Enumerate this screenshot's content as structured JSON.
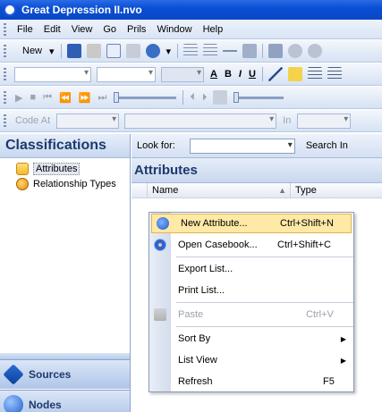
{
  "window": {
    "title": "Great Depression II.nvo"
  },
  "menubar": {
    "items": [
      "File",
      "Edit",
      "View",
      "Go",
      "Prils",
      "Window",
      "Help"
    ]
  },
  "toolbar1": {
    "new_label": "New"
  },
  "toolbar4": {
    "code_at_label": "Code At",
    "in_label": "In"
  },
  "left_panel": {
    "header": "Classifications",
    "tree": [
      {
        "label": "Attributes",
        "icon": "attributes-folder-icon",
        "selected": true
      },
      {
        "label": "Relationship Types",
        "icon": "relationship-types-icon",
        "selected": false
      }
    ],
    "nav": [
      {
        "label": "Sources",
        "icon": "sources-icon"
      },
      {
        "label": "Nodes",
        "icon": "nodes-icon"
      }
    ]
  },
  "find_bar": {
    "look_for_label": "Look for:",
    "search_in_label": "Search In"
  },
  "list": {
    "header": "Attributes",
    "columns": [
      "Name",
      "Type"
    ]
  },
  "context_menu": {
    "items": [
      {
        "label": "New Attribute...",
        "shortcut": "Ctrl+Shift+N",
        "icon": "new-attribute-icon",
        "highlighted": true
      },
      {
        "label": "Open Casebook...",
        "shortcut": "Ctrl+Shift+C",
        "icon": "casebook-icon"
      },
      {
        "label": "Export List...",
        "shortcut": ""
      },
      {
        "label": "Print List...",
        "shortcut": ""
      },
      {
        "label": "Paste",
        "shortcut": "Ctrl+V",
        "icon": "paste-icon",
        "disabled": true
      },
      {
        "label": "Sort By",
        "shortcut": "",
        "submenu": true
      },
      {
        "label": "List View",
        "shortcut": "",
        "submenu": true
      },
      {
        "label": "Refresh",
        "shortcut": "F5"
      }
    ]
  },
  "colors": {
    "titlebar": "#0a4fd4",
    "menu_highlight": "#ffe9a6",
    "panel_header_text": "#1d3a6b"
  }
}
